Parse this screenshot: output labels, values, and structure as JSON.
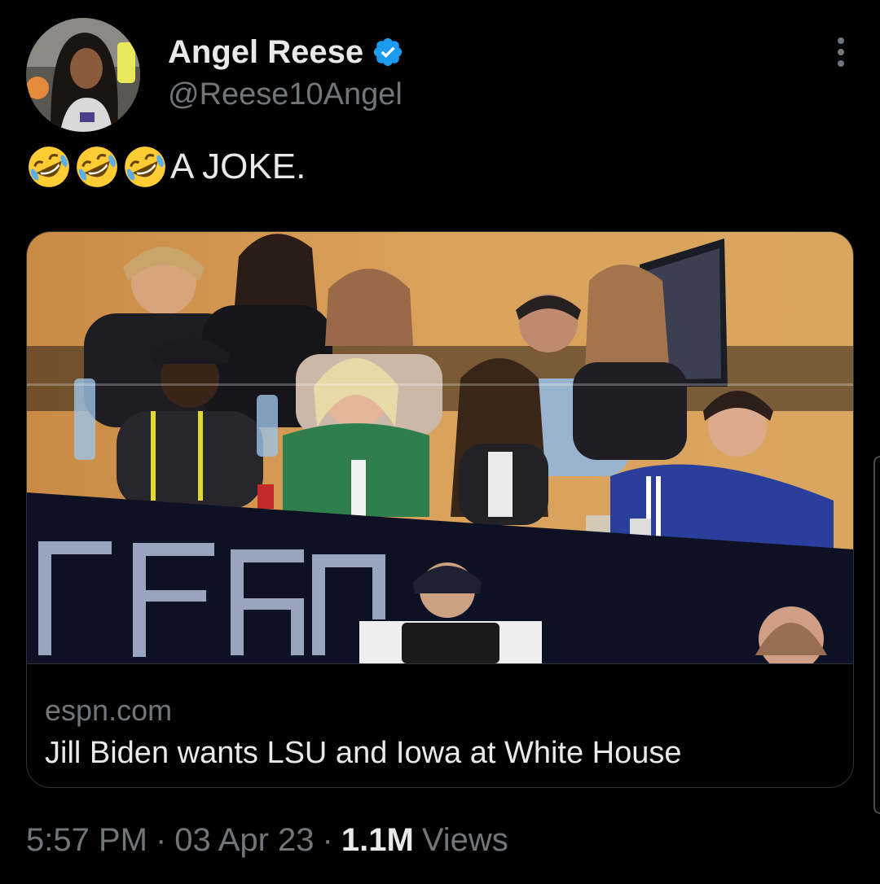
{
  "author": {
    "display_name": "Angel Reese",
    "handle": "@Reese10Angel",
    "verified": true,
    "avatar_icon": "profile-photo"
  },
  "tweet": {
    "emoji_icons": [
      "rolling-on-floor-laughing-emoji",
      "rolling-on-floor-laughing-emoji",
      "rolling-on-floor-laughing-emoji"
    ],
    "text": "A JOKE."
  },
  "link_card": {
    "domain": "espn.com",
    "title": "Jill Biden wants LSU and Iowa at White House",
    "image_icon": "arena-suite-photo"
  },
  "meta": {
    "time": "5:57 PM",
    "separator": "·",
    "date": "03 Apr 23",
    "views_count": "1.1M",
    "views_label": "Views"
  },
  "colors": {
    "background": "#000000",
    "primary_text": "#e7e9ea",
    "secondary_text": "#71767b",
    "verified_blue": "#1d9bf0",
    "border": "#2f3336"
  }
}
